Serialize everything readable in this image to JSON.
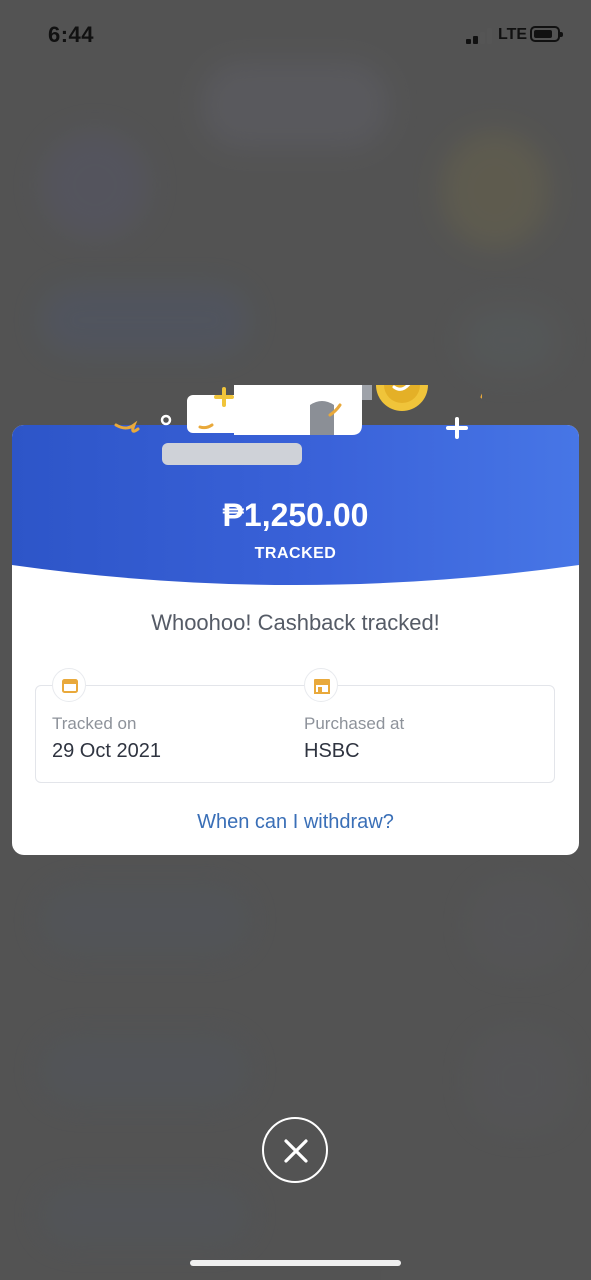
{
  "status_bar": {
    "time": "6:44",
    "network": "LTE",
    "signal_icon": "signal-bars-icon",
    "battery_icon": "battery-icon"
  },
  "card": {
    "amount": "₱1,250.00",
    "amount_status": "TRACKED",
    "headline": "Whoohoo! Cashback tracked!",
    "details": {
      "tracked_on": {
        "label": "Tracked on",
        "value": "29 Oct 2021",
        "icon": "calendar-icon"
      },
      "purchased_at": {
        "label": "Purchased at",
        "value": "HSBC",
        "icon": "store-icon"
      }
    },
    "withdraw_link": "When can I withdraw?"
  },
  "close_button": {
    "icon": "close-icon"
  },
  "colors": {
    "header_blue": "#3a62d9",
    "accent_gold": "#f0c43a",
    "link_blue": "#3a6fb7",
    "icon_gold": "#e9a93b"
  }
}
